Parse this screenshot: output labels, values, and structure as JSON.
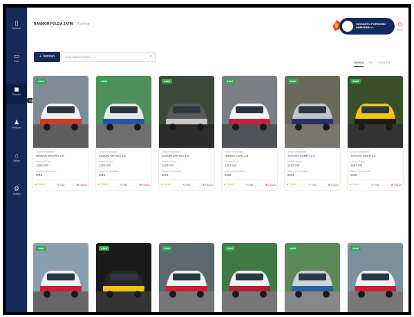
{
  "sidebar": {
    "items": [
      {
        "icon": "document-icon",
        "glyph": "▯",
        "label": "Laporan"
      },
      {
        "icon": "folder-icon",
        "glyph": "▭",
        "label": "Data"
      },
      {
        "icon": "car-icon",
        "glyph": "◼",
        "label": "Ranmor"
      },
      {
        "icon": "person-icon",
        "glyph": "♟",
        "label": "Personel"
      },
      {
        "icon": "home-icon",
        "glyph": "⌂",
        "label": "Satker"
      },
      {
        "icon": "settings-icon",
        "glyph": "⚙",
        "label": "Setting"
      }
    ],
    "tooltip": "Ranmor"
  },
  "header": {
    "breadcrumb_main": "RANMOR POLDA JATIM",
    "breadcrumb_sub": "Ranmor",
    "user_name": "SUGIANTO PURNOMO SAPUTRO",
    "user_role": "Admin Satlantas",
    "logout_label": "Keluar"
  },
  "toolbar": {
    "add_label": "+ Tambah",
    "search_placeholder": "Cari Nomor Polisi...",
    "tabs": [
      {
        "label": "Semua",
        "active": true
      },
      {
        "label": "R2"
      },
      {
        "label": "Total R4"
      }
    ]
  },
  "labels": {
    "jenis": "Jenis Kendaraan",
    "nopol": "Nomor Polisi",
    "tahun": "Tahun Pembuatan",
    "detail": "Detail",
    "edit": "Edit",
    "hapus": "Hapus"
  },
  "cards": [
    {
      "badge": "Aktif",
      "jenis": "NISSAN NAVARA 2.5",
      "nopol": "1234-VIII",
      "tahun": "2018",
      "body": "#f2f2f2",
      "accent": "#cf3a2b",
      "bg": "#7d8c96",
      "ground": "#5e5e5e"
    },
    {
      "badge": "Aktif",
      "jenis": "SUZUKI ERTIGA 1.5",
      "nopol": "1421-VIII",
      "tahun": "2019",
      "body": "#eaeaea",
      "accent": "#2556a6",
      "bg": "#4f8f5a",
      "ground": "#6f6f6f"
    },
    {
      "badge": "Aktif",
      "jenis": "SUZUKI ERTIGA 1.5",
      "nopol": "1437-VIII",
      "tahun": "2019",
      "body": "#5a5a5a",
      "accent": "#c9c9c9",
      "bg": "#3c4a3c",
      "ground": "#2c2c2c"
    },
    {
      "badge": "Aktif",
      "jenis": "HONDA CIVIC 1.8",
      "nopol": "1312-VIII",
      "tahun": "2020",
      "body": "#f4f4f4",
      "accent": "#c8203a",
      "bg": "#7b7f85",
      "ground": "#505358"
    },
    {
      "badge": "Aktif",
      "jenis": "TOYOTA CAMRY 2.5",
      "nopol": "1412-VIII",
      "tahun": "2021",
      "body": "#bfc4c9",
      "accent": "#2b2f6b",
      "bg": "#6a6a5a",
      "ground": "#7a776e"
    },
    {
      "badge": "Aktif",
      "jenis": "TOYOTA RUSH 1.5",
      "nopol": "1467-VIII",
      "tahun": "2019",
      "body": "#f1c40f",
      "accent": "#1b1b1b",
      "bg": "#3b4f2b",
      "ground": "#333333"
    },
    {
      "badge": "Aktif",
      "jenis": "",
      "nopol": "",
      "tahun": "",
      "body": "#f2f2f2",
      "accent": "#c8203a",
      "bg": "#8a9fb0",
      "ground": "#666"
    },
    {
      "badge": "Aktif",
      "jenis": "",
      "nopol": "",
      "tahun": "",
      "body": "#262626",
      "accent": "#f1c40f",
      "bg": "#1a1a1a",
      "ground": "#333"
    },
    {
      "badge": "Aktif",
      "jenis": "",
      "nopol": "",
      "tahun": "",
      "body": "#f2f2f2",
      "accent": "#c8203a",
      "bg": "#5a6a70",
      "ground": "#777"
    },
    {
      "badge": "Aktif",
      "jenis": "",
      "nopol": "",
      "tahun": "",
      "body": "#f2f2f2",
      "accent": "#b0203a",
      "bg": "#3f7a45",
      "ground": "#777"
    },
    {
      "badge": "Aktif",
      "jenis": "",
      "nopol": "",
      "tahun": "",
      "body": "#d0d4d8",
      "accent": "#2d5e9e",
      "bg": "#5a8a58",
      "ground": "#888"
    },
    {
      "badge": "Aktif",
      "jenis": "",
      "nopol": "",
      "tahun": "",
      "body": "#f2f2f2",
      "accent": "#c8203a",
      "bg": "#7b8f9c",
      "ground": "#777"
    }
  ]
}
